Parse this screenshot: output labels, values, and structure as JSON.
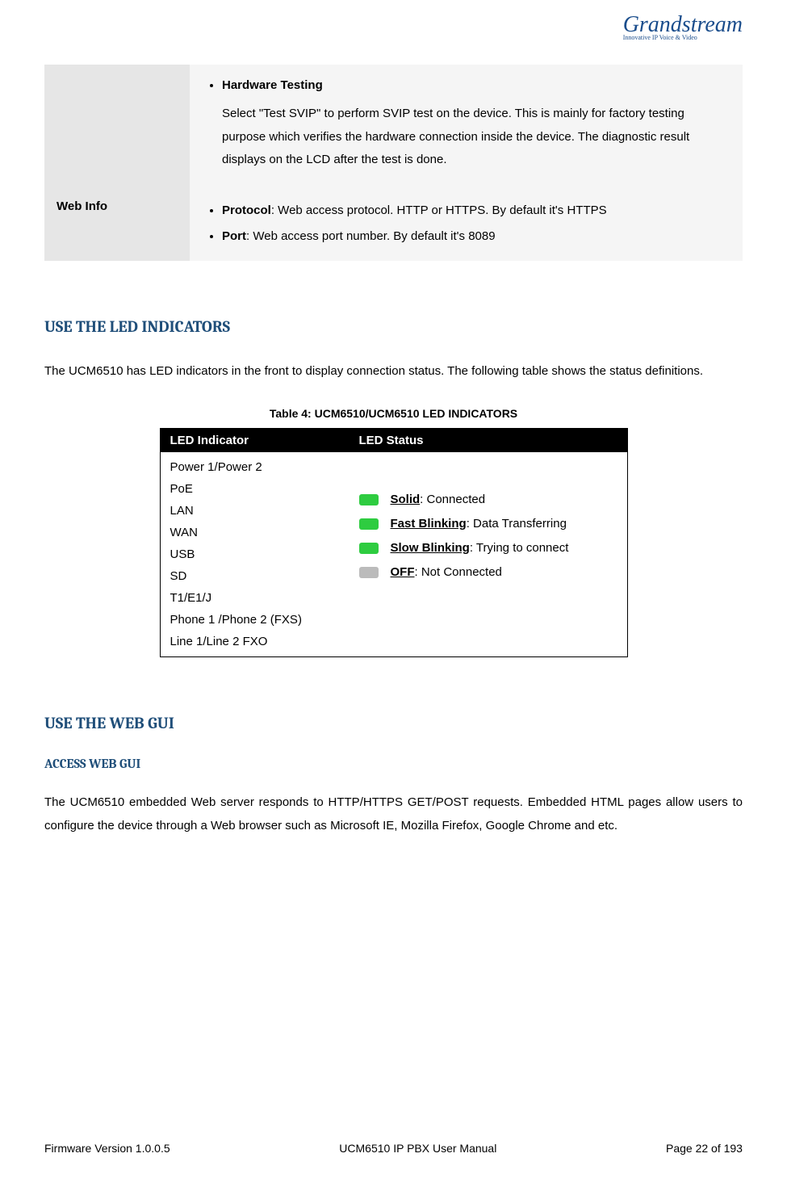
{
  "logo": {
    "brand": "Grandstream",
    "subtitle": "Innovative IP Voice & Video"
  },
  "config_table": {
    "row1": {
      "label": "",
      "bullet_title": "Hardware Testing",
      "bullet_desc": "Select \"Test SVIP\" to perform SVIP test on the device. This is mainly for factory testing purpose which verifies the hardware connection inside the device. The diagnostic result displays on the LCD after the test is done."
    },
    "row2": {
      "label": "Web Info",
      "bullets": [
        {
          "title": "Protocol",
          "desc": ": Web access protocol. HTTP or HTTPS. By default it's HTTPS"
        },
        {
          "title": "Port",
          "desc": ": Web access port number. By default it's 8089"
        }
      ]
    }
  },
  "section1": {
    "heading": "USE THE LED INDICATORS",
    "paragraph": "The UCM6510 has LED indicators in the front to display connection status. The following table shows the status definitions.",
    "table_caption": "Table 4: UCM6510/UCM6510 LED INDICATORS",
    "led_table": {
      "headers": [
        "LED Indicator",
        "LED Status"
      ],
      "indicators": [
        "Power 1/Power 2",
        "PoE",
        "LAN",
        "WAN",
        "USB",
        "SD",
        "T1/E1/J",
        "Phone 1 /Phone 2 (FXS)",
        "Line 1/Line 2 FXO"
      ],
      "statuses": [
        {
          "label": "Solid",
          "desc": ": Connected",
          "color": "green"
        },
        {
          "label": "Fast Blinking",
          "desc": ": Data Transferring",
          "color": "green"
        },
        {
          "label": "Slow Blinking",
          "desc": ": Trying to connect",
          "color": "green"
        },
        {
          "label": "OFF",
          "desc": ": Not Connected",
          "color": "gray"
        }
      ]
    }
  },
  "section2": {
    "heading": "USE THE WEB GUI",
    "subheading": "ACCESS WEB GUI",
    "paragraph": "The UCM6510 embedded Web server responds to HTTP/HTTPS GET/POST requests. Embedded HTML pages allow users to configure the device through a Web browser such as Microsoft IE, Mozilla Firefox, Google Chrome and etc."
  },
  "footer": {
    "left": "Firmware Version 1.0.0.5",
    "center": "UCM6510 IP PBX User Manual",
    "right": "Page 22 of 193"
  }
}
